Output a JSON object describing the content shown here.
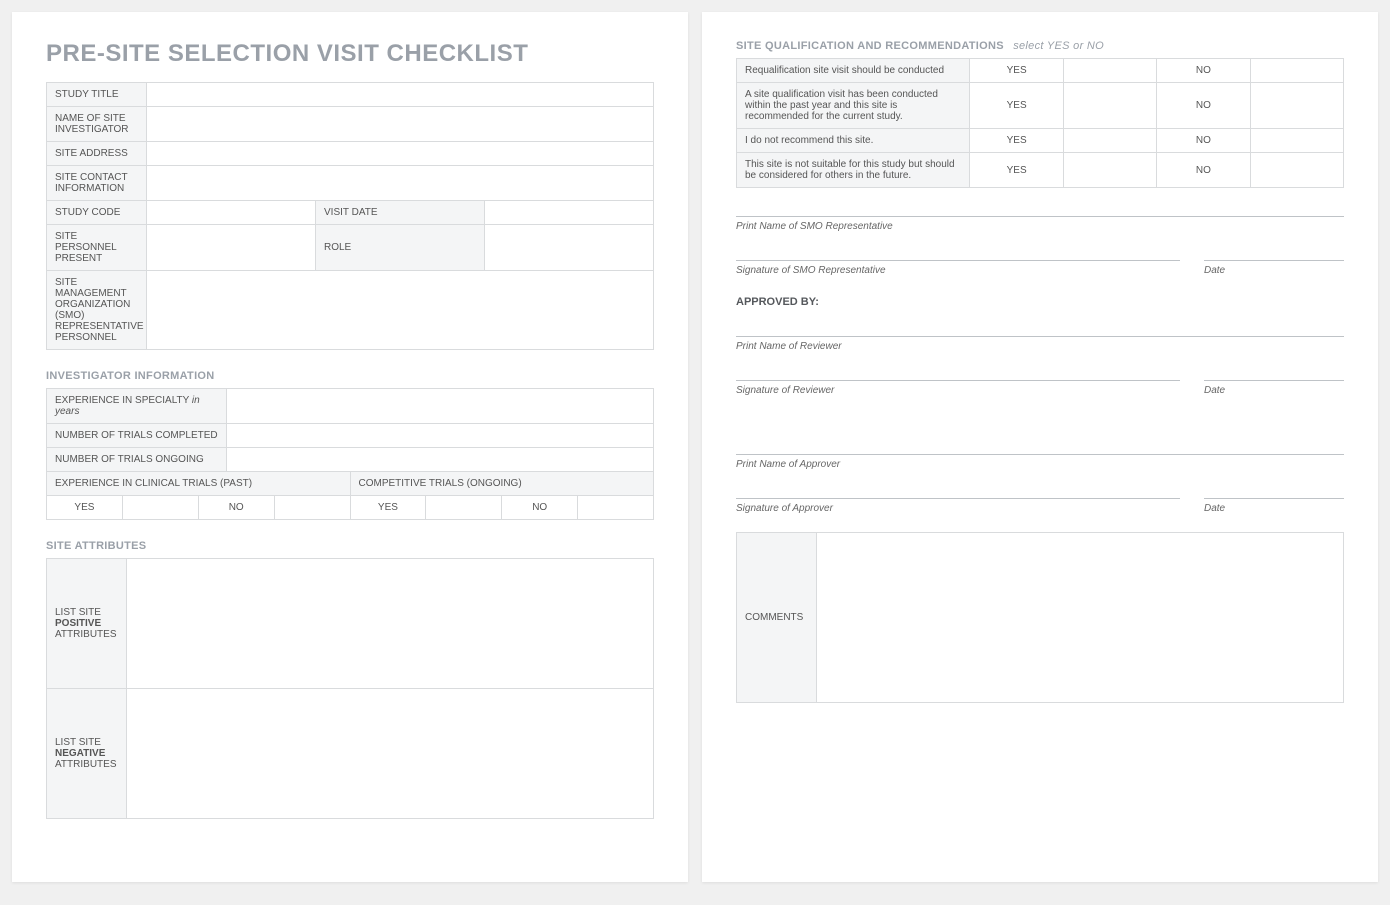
{
  "title": "PRE-SITE SELECTION VISIT CHECKLIST",
  "info": {
    "study_title": "STUDY TITLE",
    "name_investigator": "NAME OF SITE INVESTIGATOR",
    "site_address": "SITE ADDRESS",
    "site_contact": "SITE CONTACT INFORMATION",
    "study_code": "STUDY CODE",
    "visit_date": "VISIT DATE",
    "personnel_present": "SITE PERSONNEL PRESENT",
    "role": "ROLE",
    "smo": "SITE MANAGEMENT ORGANIZATION (SMO) REPRESENTATIVE PERSONNEL"
  },
  "inv_section": "INVESTIGATOR INFORMATION",
  "inv": {
    "exp_specialty": "EXPERIENCE IN SPECIALTY",
    "exp_specialty_hint": "in years",
    "trials_completed": "NUMBER OF TRIALS COMPLETED",
    "trials_ongoing": "NUMBER OF TRIALS ONGOING",
    "exp_past": "EXPERIENCE IN CLINICAL TRIALS (PAST)",
    "competitive": "COMPETITIVE TRIALS (ONGOING)",
    "yes": "YES",
    "no": "NO"
  },
  "attr_section": "SITE ATTRIBUTES",
  "attr": {
    "positive_pre": "LIST SITE",
    "positive_bold": "POSITIVE",
    "positive_post": "ATTRIBUTES",
    "negative_pre": "LIST SITE",
    "negative_bold": "NEGATIVE",
    "negative_post": "ATTRIBUTES"
  },
  "qual_section": "SITE QUALIFICATION AND RECOMMENDATIONS",
  "qual_hint": "select YES or NO",
  "qual": {
    "q1": "Requalification site visit should be conducted",
    "q2": "A site qualification visit has been conducted within the past year and this site is recommended for the current study.",
    "q3": "I do not recommend this site.",
    "q4": "This site is not suitable for this study but should be considered for others in the future.",
    "yes": "YES",
    "no": "NO"
  },
  "sigs": {
    "print_smo": "Print Name of SMO Representative",
    "sig_smo": "Signature of SMO Representative",
    "approved_by": "APPROVED BY:",
    "print_reviewer": "Print Name of Reviewer",
    "sig_reviewer": "Signature of Reviewer",
    "print_approver": "Print Name of Approver",
    "sig_approver": "Signature of Approver",
    "date": "Date"
  },
  "comments": "COMMENTS"
}
